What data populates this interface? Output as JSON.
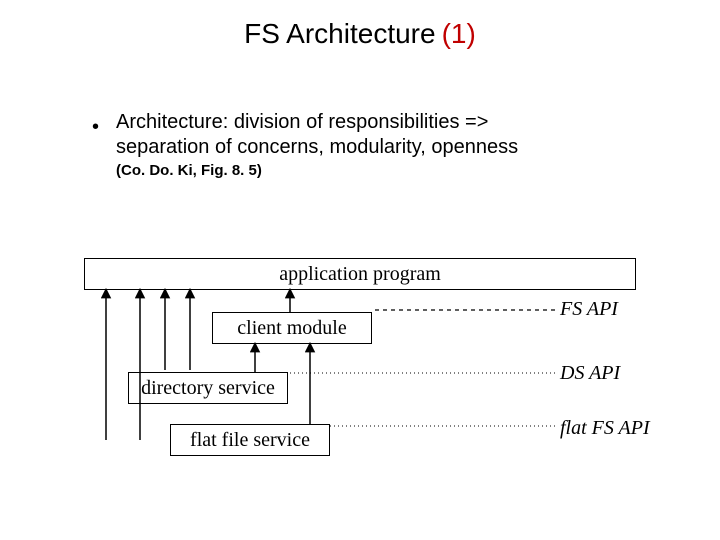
{
  "title": {
    "main": "FS Architecture",
    "sub": "(1)"
  },
  "bullet": "Architecture: division of responsibilities => separation of concerns, modularity, openness",
  "figref": "(Co. Do. Ki, Fig. 8. 5)",
  "boxes": {
    "app": "application program",
    "client": "client module",
    "dir": "directory service",
    "flat": "flat file service"
  },
  "labels": {
    "fsapi": "FS  API",
    "dsapi": "DS API",
    "flatapi": "flat FS API"
  }
}
